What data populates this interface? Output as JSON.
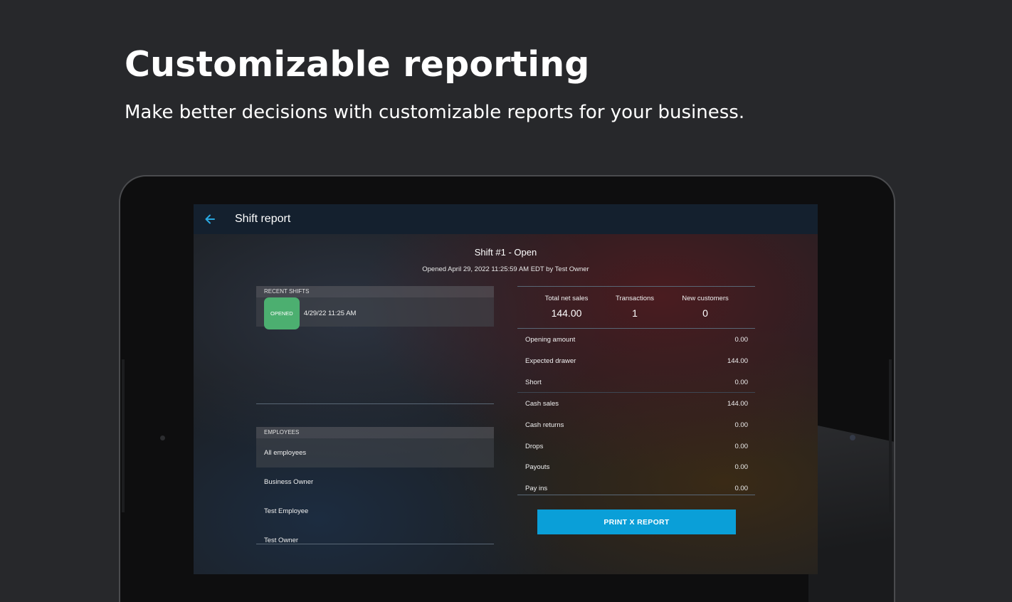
{
  "hero": {
    "title": "Customizable reporting",
    "subtitle": "Make better decisions with customizable reports for your business."
  },
  "appbar": {
    "back_icon": "arrow-left-icon",
    "title": "Shift report"
  },
  "shift": {
    "title": "Shift #1 - Open",
    "subtitle": "Opened April 29, 2022 11:25:59 AM EDT by Test Owner"
  },
  "recent_shifts": {
    "header": "RECENT SHIFTS",
    "items": [
      {
        "status": "OPENED",
        "label": "4/29/22 11:25 AM"
      }
    ]
  },
  "employees": {
    "header": "EMPLOYEES",
    "items": [
      "All employees",
      "Business Owner",
      "Test Employee",
      "Test Owner"
    ]
  },
  "summary": {
    "stats": [
      {
        "label": "Total net sales",
        "value": "144.00"
      },
      {
        "label": "Transactions",
        "value": "1"
      },
      {
        "label": "New customers",
        "value": "0"
      }
    ],
    "rows": [
      {
        "label": "Opening amount",
        "value": "0.00"
      },
      {
        "label": "Expected drawer",
        "value": "144.00"
      },
      {
        "label": "Short",
        "value": "0.00"
      },
      {
        "label": "Cash sales",
        "value": "144.00"
      },
      {
        "label": "Cash returns",
        "value": "0.00"
      },
      {
        "label": "Drops",
        "value": "0.00"
      },
      {
        "label": "Payouts",
        "value": "0.00"
      },
      {
        "label": "Pay ins",
        "value": "0.00"
      }
    ]
  },
  "actions": {
    "print_label": "PRINT X REPORT"
  },
  "colors": {
    "background": "#27282b",
    "appbar": "#14202e",
    "accent": "#0a9fd8",
    "opened_badge": "#4caf70"
  }
}
